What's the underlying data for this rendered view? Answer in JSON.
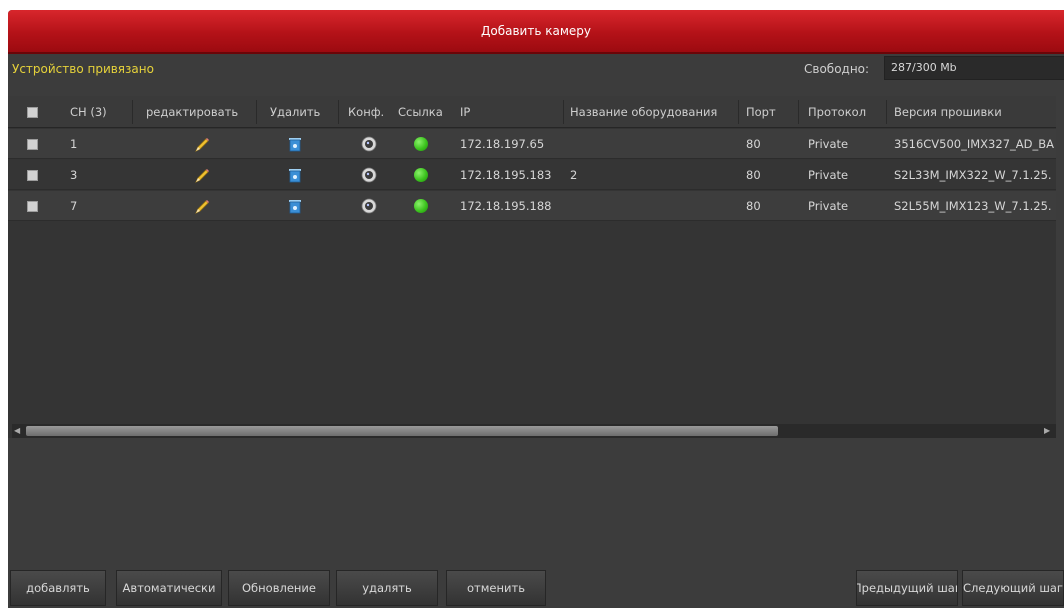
{
  "window": {
    "title": "Добавить камеру"
  },
  "status": {
    "bound_label": "Устройство привязано",
    "free_label": "Свободно:",
    "free_value": "287/300 Mb"
  },
  "table": {
    "headers": {
      "ch": "CH (3)",
      "edit": "редактировать",
      "delete": "Удалить",
      "conf": "Конф.",
      "link": "Ссылка",
      "ip": "IP",
      "device_name": "Название оборудования",
      "port": "Порт",
      "protocol": "Протокол",
      "firmware": "Версия прошивки"
    },
    "rows": [
      {
        "ch": "1",
        "ip": "172.18.197.65",
        "device_name": "",
        "port": "80",
        "protocol": "Private",
        "firmware": "3516CV500_IMX327_AD_BA"
      },
      {
        "ch": "3",
        "ip": "172.18.195.183",
        "device_name": "2",
        "port": "80",
        "protocol": "Private",
        "firmware": "S2L33M_IMX322_W_7.1.25."
      },
      {
        "ch": "7",
        "ip": "172.18.195.188",
        "device_name": "",
        "port": "80",
        "protocol": "Private",
        "firmware": "S2L55M_IMX123_W_7.1.25."
      }
    ]
  },
  "icons": {
    "edit": "pencil-icon",
    "delete": "trash-icon",
    "conf": "camera-config-icon",
    "link": "status-dot-icon",
    "link_color": "#3cc31e"
  },
  "buttons": {
    "add": "добавлять",
    "auto": "Автоматически",
    "refresh": "Обновление",
    "delete": "удалять",
    "cancel": "отменить",
    "prev": "Предыдущий шаг",
    "next": "Следующий шаг"
  },
  "colors": {
    "title_bar": "#b41218",
    "background": "#3c3c3c",
    "accent_text": "#e6d23a"
  }
}
